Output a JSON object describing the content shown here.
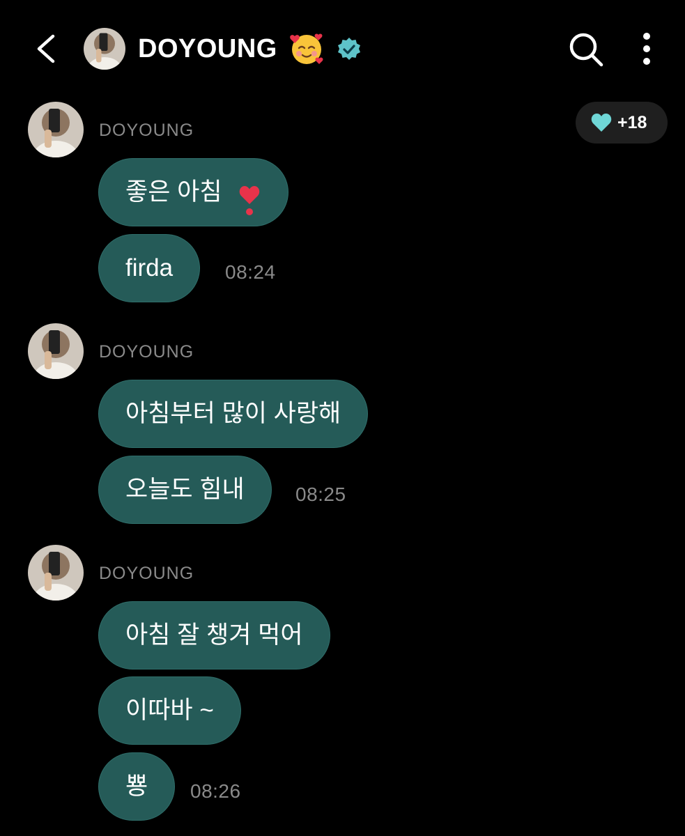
{
  "header": {
    "back_icon": "chevron-left-icon",
    "title": "DOYOUNG",
    "title_emoji": "smiling-face-with-hearts-emoji",
    "verified_icon": "verified-badge-icon",
    "search_icon": "search-icon",
    "more_icon": "more-vertical-icon"
  },
  "reaction": {
    "icon": "heart-icon",
    "count": "+18",
    "heart_color": "#6fd6d6"
  },
  "colors": {
    "background": "#000000",
    "bubble": "#255b58",
    "muted_text": "#8a8a8a",
    "verified": "#5ec3c9"
  },
  "groups": [
    {
      "sender": "DOYOUNG",
      "messages": [
        {
          "text": "좋은 아침",
          "emoji": "red-exclamation-heart-emoji"
        },
        {
          "text": "firda",
          "time": "08:24"
        }
      ]
    },
    {
      "sender": "DOYOUNG",
      "messages": [
        {
          "text": "아침부터 많이 사랑해"
        },
        {
          "text": "오늘도 힘내",
          "time": "08:25"
        }
      ]
    },
    {
      "sender": "DOYOUNG",
      "messages": [
        {
          "text": "아침 잘 챙겨 먹어"
        },
        {
          "text": "이따바 ~"
        },
        {
          "text": "뿅",
          "time": "08:26"
        }
      ]
    }
  ]
}
